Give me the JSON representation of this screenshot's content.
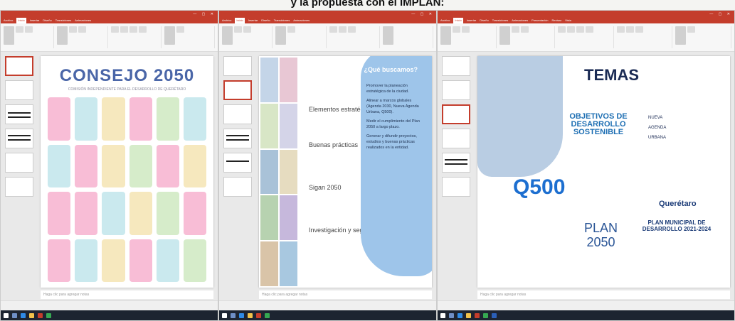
{
  "caption": "y la propuesta con el IMPLAN:",
  "app": {
    "tabs": [
      "Archivo",
      "Inicio",
      "Insertar",
      "Diseño",
      "Transiciones",
      "Animaciones",
      "Presentación",
      "Revisar",
      "Vista"
    ],
    "notes_placeholder": "Haga clic para agregar notas"
  },
  "slide1": {
    "title": "CONSEJO 2050",
    "subtitle": "COMISIÓN INDEPENDIENTE PARA EL DESARROLLO DE QUERÉTARO"
  },
  "slide2": {
    "items": [
      "Elementos estratégicos",
      "Buenas prácticas",
      "Sigan 2050",
      "Investigación y seguimiento"
    ],
    "panel_title": "¿Qué buscamos?",
    "panel_points": [
      "Promover la planeación estratégica de la ciudad.",
      "Alinear a marcos globales (Agenda 2030, Nueva Agenda Urbana, Q500).",
      "Medir el cumplimiento del Plan 2050 a largo plazo.",
      "Generar y difundir proyectos, estudios y buenas prácticas realizados en la entidad."
    ]
  },
  "slide3": {
    "title": "TEMAS",
    "ods": "OBJETIVOS DE DESARROLLO SOSTENIBLE",
    "nau": [
      "NUEVA",
      "AGENDA",
      "URBANA"
    ],
    "q500": "Q500",
    "plan": [
      "PLAN",
      "2050"
    ],
    "queretaro_brand": "Querétaro",
    "queretaro": "PLAN MUNICIPAL DE DESARROLLO 2021-2024"
  },
  "colors": {
    "titlebar": "#c43d2c",
    "blob_blue": "#9ec5ea",
    "navy": "#1b2b54"
  }
}
